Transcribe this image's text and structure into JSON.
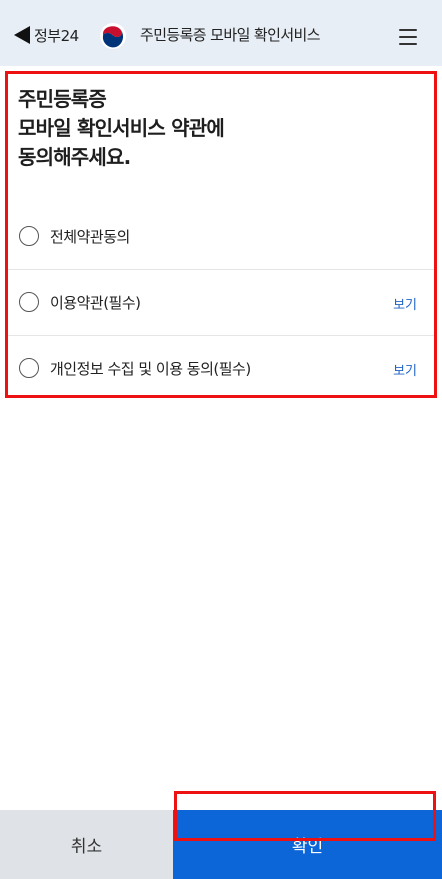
{
  "header": {
    "back_label": "정부24",
    "title": "주민등록증 모바일 확인서비스",
    "emblem_icon": "government-emblem-icon",
    "menu_icon": "hamburger-menu-icon"
  },
  "main": {
    "title_lines": [
      "주민등록증",
      "모바일 확인서비스 약관에",
      "동의해주세요."
    ],
    "terms": [
      {
        "label": "전체약관동의",
        "checked": false
      },
      {
        "label": "이용약관(필수)",
        "checked": false,
        "view_label": "보기"
      },
      {
        "label": "개인정보 수집 및 이용 동의(필수)",
        "checked": false,
        "view_label": "보기"
      }
    ]
  },
  "footer": {
    "cancel_label": "취소",
    "confirm_label": "확인"
  },
  "colors": {
    "header_bg": "#e8eef5",
    "confirm_bg": "#0c66d8",
    "cancel_bg": "#dfe2e6",
    "link": "#1f63c6",
    "highlight": "#ee1111"
  }
}
